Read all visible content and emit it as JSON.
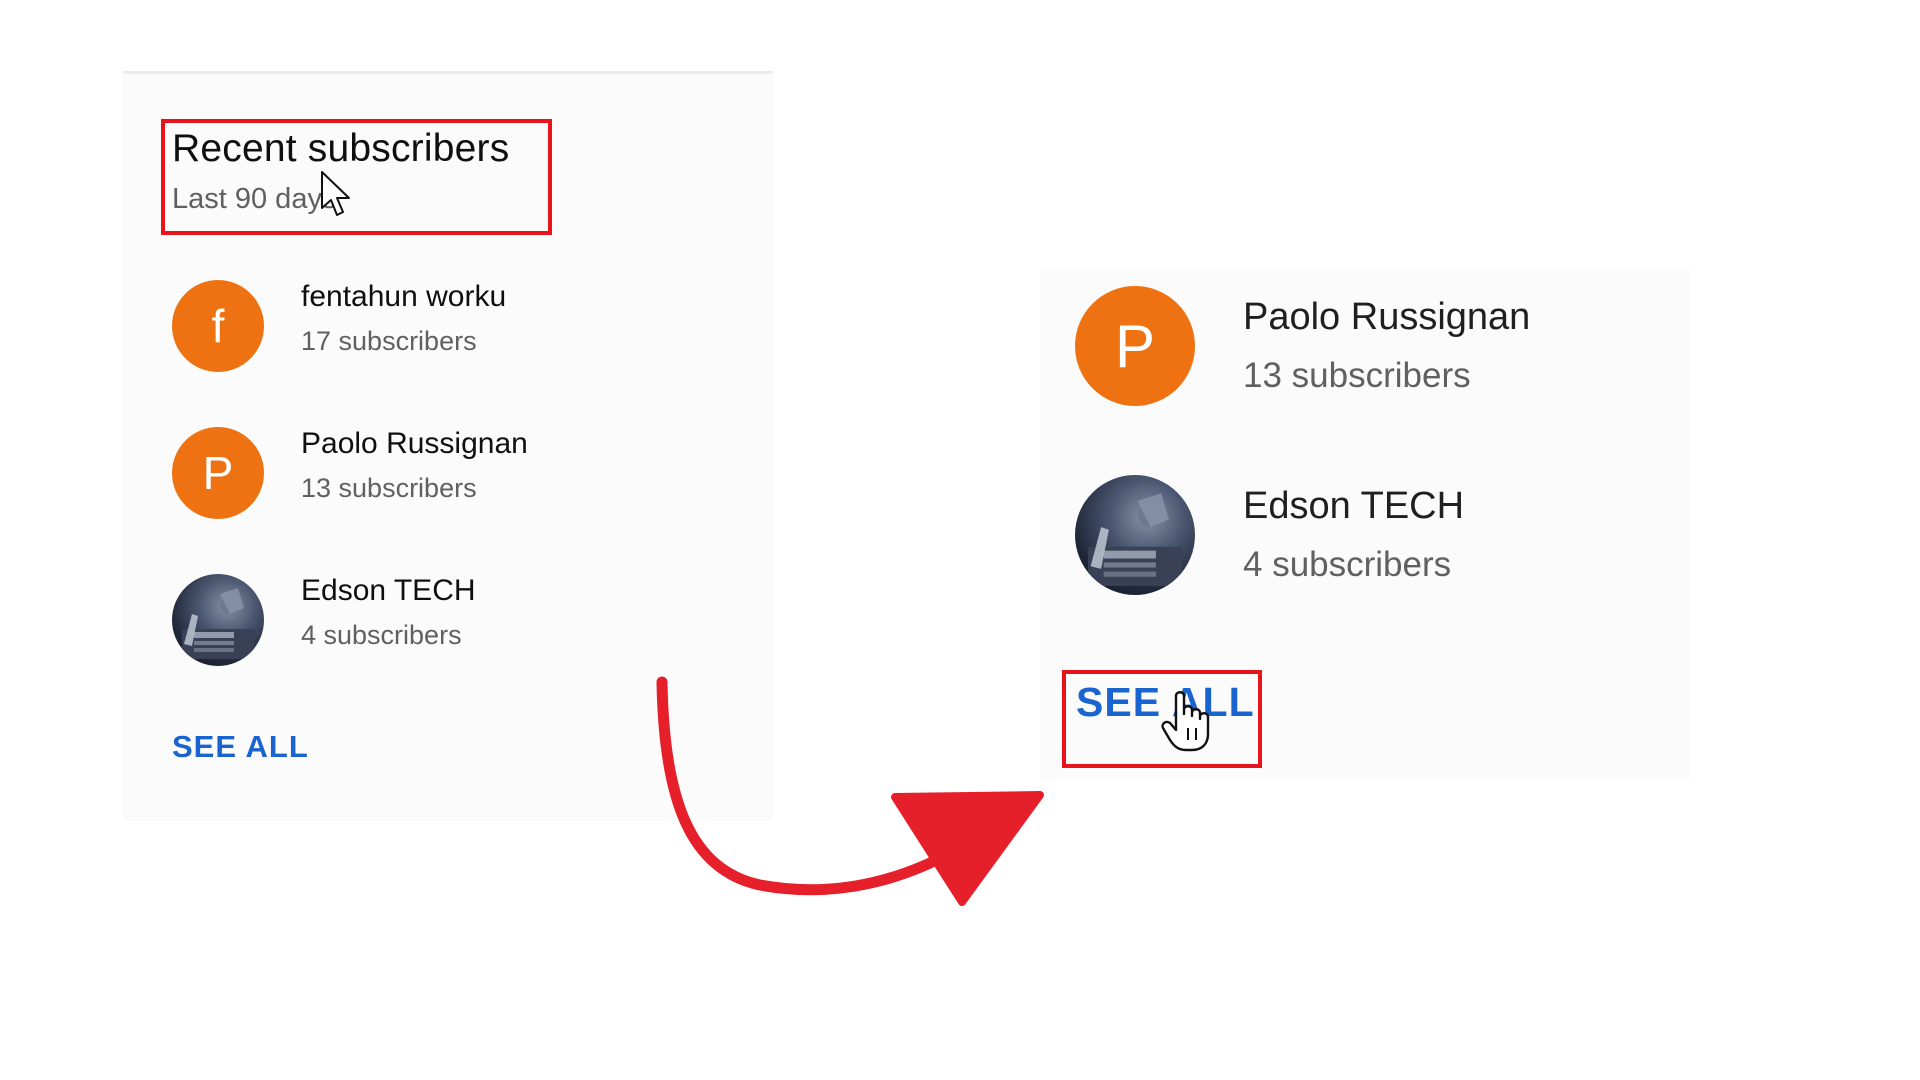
{
  "left_panel": {
    "title": "Recent subscribers",
    "subtitle": "Last 90 days",
    "subscribers": [
      {
        "initial": "f",
        "name": "fentahun worku",
        "count": "17 subscribers",
        "avatar_color": "#ee7211"
      },
      {
        "initial": "P",
        "name": "Paolo Russignan",
        "count": "13 subscribers",
        "avatar_color": "#ee7211"
      },
      {
        "initial": "",
        "name": "Edson TECH",
        "count": "4 subscribers",
        "avatar_color": "#1f2638"
      }
    ],
    "see_all_label": "SEE ALL"
  },
  "right_panel": {
    "subscribers": [
      {
        "initial": "P",
        "name": "Paolo Russignan",
        "count": "13 subscribers",
        "avatar_color": "#ee7211"
      },
      {
        "initial": "",
        "name": "Edson TECH",
        "count": "4 subscribers",
        "avatar_color": "#1f2638"
      }
    ],
    "see_all_label": "SEE ALL"
  },
  "colors": {
    "highlight": "#e8131b",
    "link": "#1a64d0",
    "avatar_orange": "#ee7211",
    "arrow": "#e5202a"
  },
  "icons": {
    "pointer_cursor": "arrow-cursor-icon",
    "hand_cursor": "hand-cursor-icon",
    "annotation_arrow": "curved-arrow-icon"
  }
}
